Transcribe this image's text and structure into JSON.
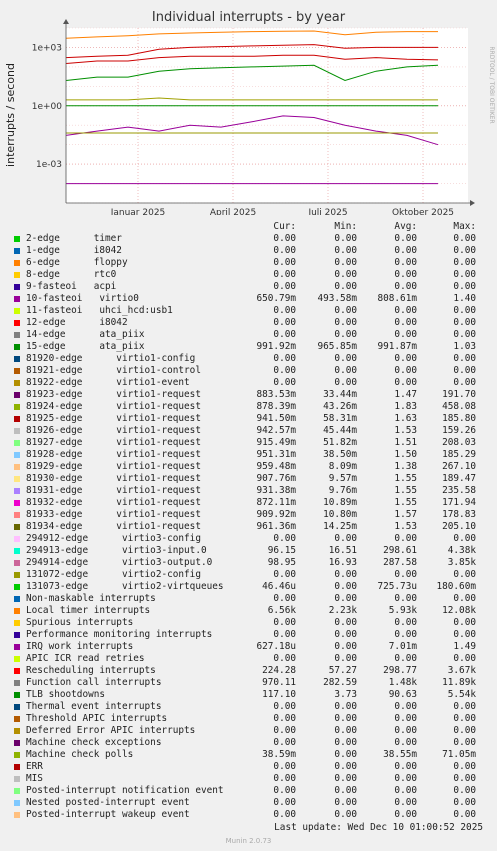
{
  "title": "Individual interrupts - by year",
  "ylabel": "interrupts / second",
  "side_label": "RRDTOOL / TOBI OETIKER",
  "footer": "Last update: Wed Dec 10 01:00:52 2025",
  "munin": "Munin 2.0.73",
  "headers": {
    "cur": "Cur:",
    "min": "Min:",
    "avg": "Avg:",
    "max": "Max:"
  },
  "chart_data": {
    "type": "line",
    "title": "Individual interrupts - by year",
    "ylabel": "interrupts / second",
    "yscale": "log",
    "ylim": [
      1e-05,
      10000
    ],
    "yticks": [
      "1e+03",
      "1e+00",
      "1e-03"
    ],
    "xticks": [
      "Januar 2025",
      "April 2025",
      "Juli 2025",
      "Oktober 2025"
    ],
    "grid": true,
    "series": [
      {
        "name": "10-fasteoi virtio0",
        "color": "#990099",
        "cur": 0.6508,
        "values": [
          0.03,
          0.05,
          0.08,
          0.05,
          0.1,
          0.08,
          0.15,
          0.3,
          0.25,
          0.1,
          0.05,
          0.03,
          0.01
        ]
      },
      {
        "name": "15-edge ata_piix",
        "color": "#008f00",
        "cur": 0.99192,
        "values": [
          1,
          1,
          1,
          1,
          1,
          1,
          1,
          1,
          1,
          1,
          1,
          1,
          1
        ]
      },
      {
        "name": "Local timer interrupts",
        "color": "#ff8000",
        "cur": 6560,
        "values": [
          3000,
          3500,
          4000,
          5000,
          5500,
          6000,
          6500,
          6800,
          7000,
          4500,
          6000,
          6500,
          6500
        ]
      },
      {
        "name": "Function call interrupts",
        "color": "#cc0000",
        "cur": 970.11,
        "values": [
          300,
          350,
          400,
          800,
          1000,
          1100,
          1200,
          1300,
          1400,
          900,
          1000,
          1000,
          1000
        ]
      },
      {
        "name": "TLB shootdowns",
        "color": "#008f00",
        "cur": 117.1,
        "values": [
          20,
          30,
          30,
          60,
          80,
          90,
          100,
          110,
          120,
          20,
          60,
          100,
          120
        ]
      },
      {
        "name": "Rescheduling interrupts",
        "color": "#cc0000",
        "cur": 224.28,
        "values": [
          150,
          200,
          200,
          300,
          350,
          350,
          350,
          400,
          400,
          250,
          300,
          250,
          230
        ]
      },
      {
        "name": "294912-edge virtio3-config",
        "color": "#a0a000",
        "cur": 96.15,
        "values": [
          2,
          2,
          2,
          2.5,
          2,
          2,
          2,
          2,
          2,
          2,
          2,
          2,
          2
        ]
      },
      {
        "name": "Machine check polls",
        "color": "#999900",
        "cur": 0.03859,
        "values": [
          0.04,
          0.04,
          0.04,
          0.04,
          0.04,
          0.04,
          0.04,
          0.04,
          0.04,
          0.04,
          0.04,
          0.04,
          0.04
        ]
      },
      {
        "name": "IRQ work interrupts",
        "color": "#990099",
        "cur": 0.000627,
        "values": [
          0.0001,
          0.0001,
          0.0001,
          0.0001,
          0.0001,
          0.0001,
          0.0001,
          0.0001,
          0.0001,
          0.0001,
          0.0001,
          0.0001,
          0.0001
        ]
      }
    ]
  },
  "legend": [
    {
      "label": "2-edge      timer",
      "color": "#00cc00",
      "cur": "0.00",
      "min": "0.00",
      "avg": "0.00",
      "max": "0.00"
    },
    {
      "label": "1-edge      i8042",
      "color": "#0066b3",
      "cur": "0.00",
      "min": "0.00",
      "avg": "0.00",
      "max": "0.00"
    },
    {
      "label": "6-edge      floppy",
      "color": "#ff8000",
      "cur": "0.00",
      "min": "0.00",
      "avg": "0.00",
      "max": "0.00"
    },
    {
      "label": "8-edge      rtc0",
      "color": "#ffcc00",
      "cur": "0.00",
      "min": "0.00",
      "avg": "0.00",
      "max": "0.00"
    },
    {
      "label": "9-fasteoi   acpi",
      "color": "#330099",
      "cur": "0.00",
      "min": "0.00",
      "avg": "0.00",
      "max": "0.00"
    },
    {
      "label": "10-fasteoi   virtio0",
      "color": "#990099",
      "cur": "650.79m",
      "min": "493.58m",
      "avg": "808.61m",
      "max": "1.40"
    },
    {
      "label": "11-fasteoi   uhci_hcd:usb1",
      "color": "#ccff00",
      "cur": "0.00",
      "min": "0.00",
      "avg": "0.00",
      "max": "0.00"
    },
    {
      "label": "12-edge      i8042",
      "color": "#ff0000",
      "cur": "0.00",
      "min": "0.00",
      "avg": "0.00",
      "max": "0.00"
    },
    {
      "label": "14-edge      ata_piix",
      "color": "#808080",
      "cur": "0.00",
      "min": "0.00",
      "avg": "0.00",
      "max": "0.00"
    },
    {
      "label": "15-edge      ata_piix",
      "color": "#008f00",
      "cur": "991.92m",
      "min": "965.85m",
      "avg": "991.87m",
      "max": "1.03"
    },
    {
      "label": "81920-edge      virtio1-config",
      "color": "#00487d",
      "cur": "0.00",
      "min": "0.00",
      "avg": "0.00",
      "max": "0.00"
    },
    {
      "label": "81921-edge      virtio1-control",
      "color": "#b35a00",
      "cur": "0.00",
      "min": "0.00",
      "avg": "0.00",
      "max": "0.00"
    },
    {
      "label": "81922-edge      virtio1-event",
      "color": "#b38f00",
      "cur": "0.00",
      "min": "0.00",
      "avg": "0.00",
      "max": "0.00"
    },
    {
      "label": "81923-edge      virtio1-request",
      "color": "#6b006b",
      "cur": "883.53m",
      "min": "33.44m",
      "avg": "1.47",
      "max": "191.70"
    },
    {
      "label": "81924-edge      virtio1-request",
      "color": "#8fb300",
      "cur": "878.39m",
      "min": "43.26m",
      "avg": "1.83",
      "max": "458.08"
    },
    {
      "label": "81925-edge      virtio1-request",
      "color": "#b30000",
      "cur": "941.50m",
      "min": "58.31m",
      "avg": "1.63",
      "max": "185.80"
    },
    {
      "label": "81926-edge      virtio1-request",
      "color": "#bebebe",
      "cur": "942.57m",
      "min": "45.44m",
      "avg": "1.53",
      "max": "159.26"
    },
    {
      "label": "81927-edge      virtio1-request",
      "color": "#80ff80",
      "cur": "915.49m",
      "min": "51.82m",
      "avg": "1.51",
      "max": "208.03"
    },
    {
      "label": "81928-edge      virtio1-request",
      "color": "#80c9ff",
      "cur": "951.31m",
      "min": "38.50m",
      "avg": "1.50",
      "max": "185.29"
    },
    {
      "label": "81929-edge      virtio1-request",
      "color": "#ffc080",
      "cur": "959.48m",
      "min": "8.09m",
      "avg": "1.38",
      "max": "267.10"
    },
    {
      "label": "81930-edge      virtio1-request",
      "color": "#ffe680",
      "cur": "907.76m",
      "min": "9.57m",
      "avg": "1.55",
      "max": "189.47"
    },
    {
      "label": "81931-edge      virtio1-request",
      "color": "#aa80ff",
      "cur": "931.38m",
      "min": "9.76m",
      "avg": "1.55",
      "max": "235.58"
    },
    {
      "label": "81932-edge      virtio1-request",
      "color": "#ee00cc",
      "cur": "872.11m",
      "min": "10.89m",
      "avg": "1.55",
      "max": "171.94"
    },
    {
      "label": "81933-edge      virtio1-request",
      "color": "#ff8080",
      "cur": "909.92m",
      "min": "10.80m",
      "avg": "1.57",
      "max": "178.83"
    },
    {
      "label": "81934-edge      virtio1-request",
      "color": "#666600",
      "cur": "961.36m",
      "min": "14.25m",
      "avg": "1.53",
      "max": "205.10"
    },
    {
      "label": "294912-edge      virtio3-config",
      "color": "#ffbfff",
      "cur": "0.00",
      "min": "0.00",
      "avg": "0.00",
      "max": "0.00"
    },
    {
      "label": "294913-edge      virtio3-input.0",
      "color": "#00ffcc",
      "cur": "96.15",
      "min": "16.51",
      "avg": "298.61",
      "max": "4.38k"
    },
    {
      "label": "294914-edge      virtio3-output.0",
      "color": "#cc6699",
      "cur": "98.95",
      "min": "16.93",
      "avg": "287.58",
      "max": "3.85k"
    },
    {
      "label": "131072-edge      virtio2-config",
      "color": "#999900",
      "cur": "0.00",
      "min": "0.00",
      "avg": "0.00",
      "max": "0.00"
    },
    {
      "label": "131073-edge      virtio2-virtqueues",
      "color": "#00cc00",
      "cur": "46.46u",
      "min": "0.00",
      "avg": "725.73u",
      "max": "180.60m"
    },
    {
      "label": "Non-maskable interrupts",
      "color": "#0066b3",
      "cur": "0.00",
      "min": "0.00",
      "avg": "0.00",
      "max": "0.00"
    },
    {
      "label": "Local timer interrupts",
      "color": "#ff8000",
      "cur": "6.56k",
      "min": "2.23k",
      "avg": "5.93k",
      "max": "12.08k"
    },
    {
      "label": "Spurious interrupts",
      "color": "#ffcc00",
      "cur": "0.00",
      "min": "0.00",
      "avg": "0.00",
      "max": "0.00"
    },
    {
      "label": "Performance monitoring interrupts",
      "color": "#330099",
      "cur": "0.00",
      "min": "0.00",
      "avg": "0.00",
      "max": "0.00"
    },
    {
      "label": "IRQ work interrupts",
      "color": "#990099",
      "cur": "627.18u",
      "min": "0.00",
      "avg": "7.01m",
      "max": "1.49"
    },
    {
      "label": "APIC ICR read retries",
      "color": "#ccff00",
      "cur": "0.00",
      "min": "0.00",
      "avg": "0.00",
      "max": "0.00"
    },
    {
      "label": "Rescheduling interrupts",
      "color": "#ff0000",
      "cur": "224.28",
      "min": "57.27",
      "avg": "298.77",
      "max": "3.67k"
    },
    {
      "label": "Function call interrupts",
      "color": "#808080",
      "cur": "970.11",
      "min": "282.59",
      "avg": "1.48k",
      "max": "11.89k"
    },
    {
      "label": "TLB shootdowns",
      "color": "#008f00",
      "cur": "117.10",
      "min": "3.73",
      "avg": "90.63",
      "max": "5.54k"
    },
    {
      "label": "Thermal event interrupts",
      "color": "#00487d",
      "cur": "0.00",
      "min": "0.00",
      "avg": "0.00",
      "max": "0.00"
    },
    {
      "label": "Threshold APIC interrupts",
      "color": "#b35a00",
      "cur": "0.00",
      "min": "0.00",
      "avg": "0.00",
      "max": "0.00"
    },
    {
      "label": "Deferred Error APIC interrupts",
      "color": "#b38f00",
      "cur": "0.00",
      "min": "0.00",
      "avg": "0.00",
      "max": "0.00"
    },
    {
      "label": "Machine check exceptions",
      "color": "#6b006b",
      "cur": "0.00",
      "min": "0.00",
      "avg": "0.00",
      "max": "0.00"
    },
    {
      "label": "Machine check polls",
      "color": "#8fb300",
      "cur": "38.59m",
      "min": "0.00",
      "avg": "38.55m",
      "max": "71.05m"
    },
    {
      "label": "ERR",
      "color": "#b30000",
      "cur": "0.00",
      "min": "0.00",
      "avg": "0.00",
      "max": "0.00"
    },
    {
      "label": "MIS",
      "color": "#bebebe",
      "cur": "0.00",
      "min": "0.00",
      "avg": "0.00",
      "max": "0.00"
    },
    {
      "label": "Posted-interrupt notification event",
      "color": "#80ff80",
      "cur": "0.00",
      "min": "0.00",
      "avg": "0.00",
      "max": "0.00"
    },
    {
      "label": "Nested posted-interrupt event",
      "color": "#80c9ff",
      "cur": "0.00",
      "min": "0.00",
      "avg": "0.00",
      "max": "0.00"
    },
    {
      "label": "Posted-interrupt wakeup event",
      "color": "#ffc080",
      "cur": "0.00",
      "min": "0.00",
      "avg": "0.00",
      "max": "0.00"
    }
  ]
}
